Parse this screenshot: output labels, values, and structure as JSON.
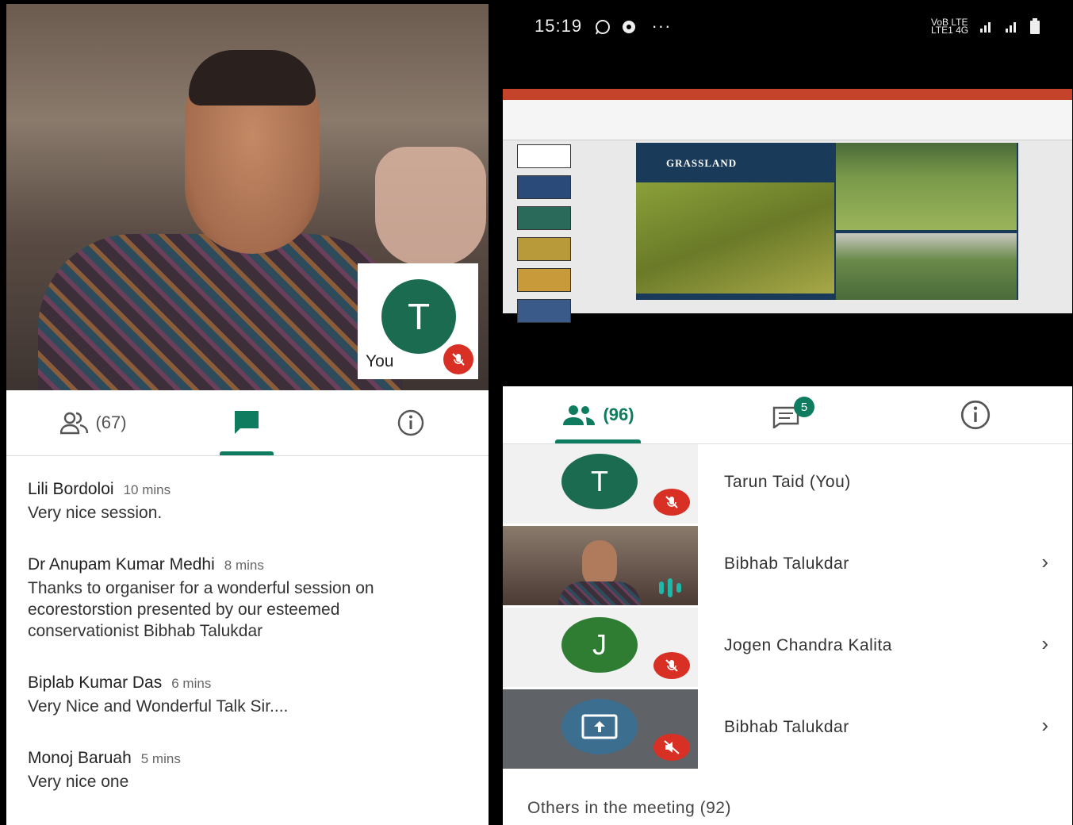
{
  "left": {
    "self_tile": {
      "avatar_letter": "T",
      "label": "You"
    },
    "tabs": {
      "people_count": "(67)"
    },
    "messages": [
      {
        "sender": "Lili Bordoloi",
        "time": "10 mins",
        "text": "Very nice session."
      },
      {
        "sender": "Dr Anupam Kumar Medhi",
        "time": "8 mins",
        "text": "Thanks to organiser for a wonderful session on ecorestorstion presented by our esteemed conservationist Bibhab Talukdar"
      },
      {
        "sender": "Biplab Kumar Das",
        "time": "6 mins",
        "text": "Very Nice and Wonderful Talk Sir...."
      },
      {
        "sender": "Monoj Baruah",
        "time": "5 mins",
        "text": "Very nice one"
      }
    ]
  },
  "right": {
    "status_bar": {
      "time": "15:19",
      "dots": "···",
      "network": "VoB LTE LTE1 4G"
    },
    "slide": {
      "title": "GRASSLAND"
    },
    "tabs": {
      "people_count": "(96)",
      "chat_badge": "5"
    },
    "participants": [
      {
        "avatar_letter": "T",
        "name": "Tarun Taid (You)",
        "avatar_color": "#1a6b4f",
        "has_chevron": false
      },
      {
        "avatar_letter": "",
        "name": "Bibhab Talukdar",
        "has_chevron": true
      },
      {
        "avatar_letter": "J",
        "name": "Jogen Chandra Kalita",
        "avatar_color": "#2e7d32",
        "has_chevron": true
      },
      {
        "avatar_letter": "",
        "name": "Bibhab Talukdar",
        "has_chevron": true
      }
    ],
    "others_label": "Others in the meeting (92)",
    "chevron": "›"
  },
  "colors": {
    "accent": "#0f7b5f",
    "mute": "#d93025",
    "avatar": "#1a6b4f"
  }
}
